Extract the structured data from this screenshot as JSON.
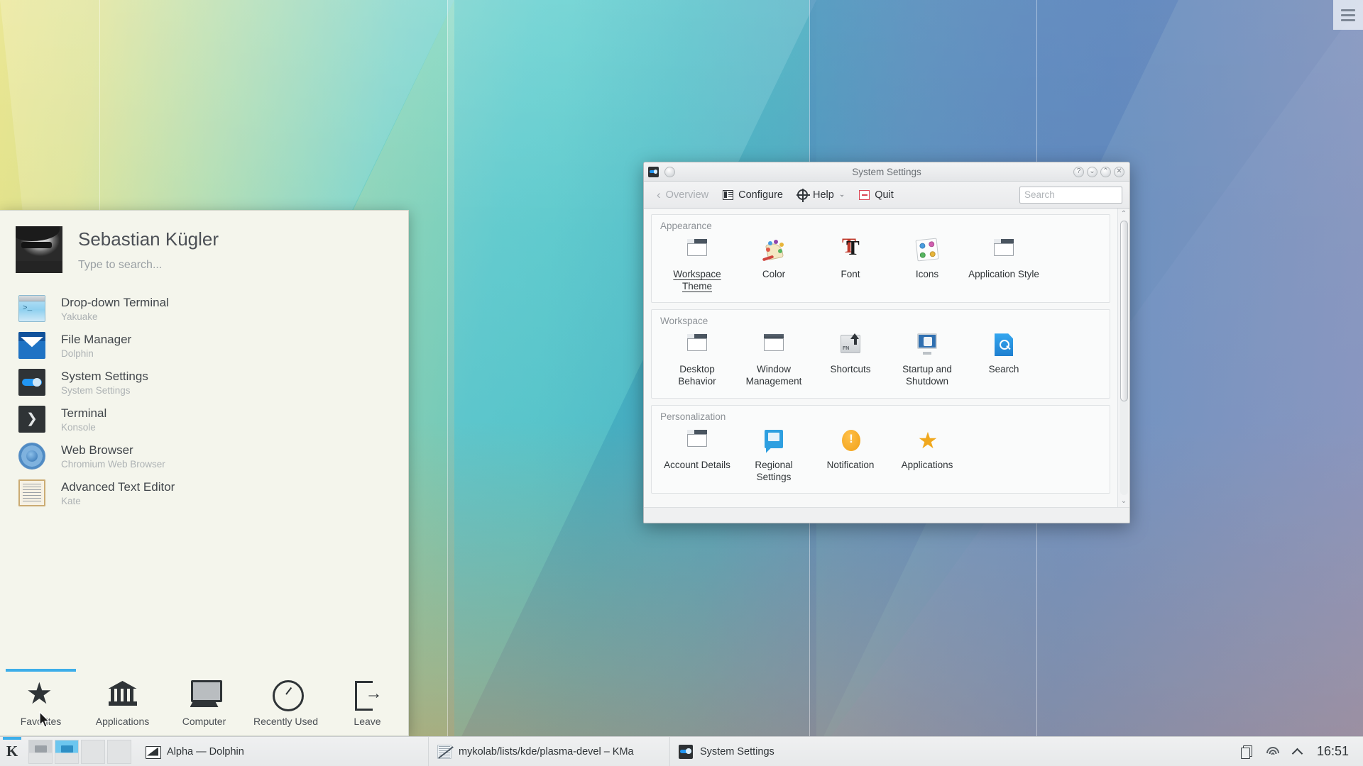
{
  "desktop": {
    "toolbox_icon": "hamburger-menu-icon"
  },
  "launcher": {
    "user_name": "Sebastian Kügler",
    "search_placeholder": "Type to search...",
    "avatar_icon": "user-avatar",
    "favorites": [
      {
        "title": "Drop-down Terminal",
        "subtitle": "Yakuake",
        "icon": "yakuake-icon"
      },
      {
        "title": "File Manager",
        "subtitle": "Dolphin",
        "icon": "dolphin-icon"
      },
      {
        "title": "System Settings",
        "subtitle": "System Settings",
        "icon": "system-settings-icon"
      },
      {
        "title": "Terminal",
        "subtitle": "Konsole",
        "icon": "konsole-icon"
      },
      {
        "title": "Web Browser",
        "subtitle": "Chromium Web Browser",
        "icon": "chromium-icon"
      },
      {
        "title": "Advanced Text Editor",
        "subtitle": "Kate",
        "icon": "kate-icon"
      }
    ],
    "tabs": [
      {
        "label": "Favorites",
        "icon": "star-icon",
        "active": true
      },
      {
        "label": "Applications",
        "icon": "bank-icon",
        "active": false
      },
      {
        "label": "Computer",
        "icon": "monitor-icon",
        "active": false
      },
      {
        "label": "Recently Used",
        "icon": "clock-icon",
        "active": false
      },
      {
        "label": "Leave",
        "icon": "logout-icon",
        "active": false
      }
    ]
  },
  "system_settings": {
    "window_title": "System Settings",
    "window_buttons": [
      {
        "name": "help-button",
        "glyph": "?"
      },
      {
        "name": "minimize-button",
        "glyph": "⌄"
      },
      {
        "name": "maximize-button",
        "glyph": "⌃"
      },
      {
        "name": "close-button",
        "glyph": "✕"
      }
    ],
    "toolbar": {
      "back_label": "Overview",
      "configure_label": "Configure",
      "help_label": "Help",
      "quit_label": "Quit"
    },
    "search_placeholder": "Search",
    "sections": [
      {
        "title": "Appearance",
        "items": [
          {
            "label": "Workspace Theme",
            "icon": "window-theme-icon",
            "selected": true
          },
          {
            "label": "Color",
            "icon": "color-palette-icon",
            "selected": false
          },
          {
            "label": "Font",
            "icon": "font-icon",
            "selected": false
          },
          {
            "label": "Icons",
            "icon": "icons-theme-icon",
            "selected": false
          },
          {
            "label": "Application Style",
            "icon": "window-style-icon",
            "selected": false
          }
        ]
      },
      {
        "title": "Workspace",
        "items": [
          {
            "label": "Desktop Behavior",
            "icon": "desktop-window-icon",
            "selected": false
          },
          {
            "label": "Window Management",
            "icon": "window-manage-icon",
            "selected": false
          },
          {
            "label": "Shortcuts",
            "icon": "keyboard-key-icon",
            "selected": false
          },
          {
            "label": "Startup and Shutdown",
            "icon": "monitor-startup-icon",
            "selected": false
          },
          {
            "label": "Search",
            "icon": "search-file-icon",
            "selected": false
          }
        ]
      },
      {
        "title": "Personalization",
        "items": [
          {
            "label": "Account Details",
            "icon": "account-window-icon",
            "selected": false
          },
          {
            "label": "Regional Settings",
            "icon": "speech-bubble-icon",
            "selected": false
          },
          {
            "label": "Notification",
            "icon": "warning-circle-icon",
            "selected": false
          },
          {
            "label": "Applications",
            "icon": "star-icon",
            "selected": false
          }
        ]
      }
    ]
  },
  "taskbar": {
    "kmenu_icon": "kde-k-icon",
    "pager_desktops": [
      {
        "state": "inactive"
      },
      {
        "state": "active"
      },
      {
        "state": "inactive"
      },
      {
        "state": "inactive"
      }
    ],
    "tasks": [
      {
        "label": "Alpha — Dolphin",
        "icon": "folder-icon"
      },
      {
        "label": "mykolab/lists/kde/plasma-devel – KMa",
        "icon": "kmail-icon"
      },
      {
        "label": "System Settings",
        "icon": "system-settings-icon"
      }
    ],
    "tray": [
      {
        "name": "clipboard-icon"
      },
      {
        "name": "wifi-icon"
      },
      {
        "name": "chevron-up-icon"
      }
    ],
    "clock": "16:51"
  },
  "colors": {
    "accent": "#3daee9",
    "launcher_bg": "#f4f5ec",
    "window_bg": "#eff0f1",
    "quit_red": "#da4453",
    "notify_orange": "#f0a016",
    "star_gold": "#f0a81e"
  }
}
